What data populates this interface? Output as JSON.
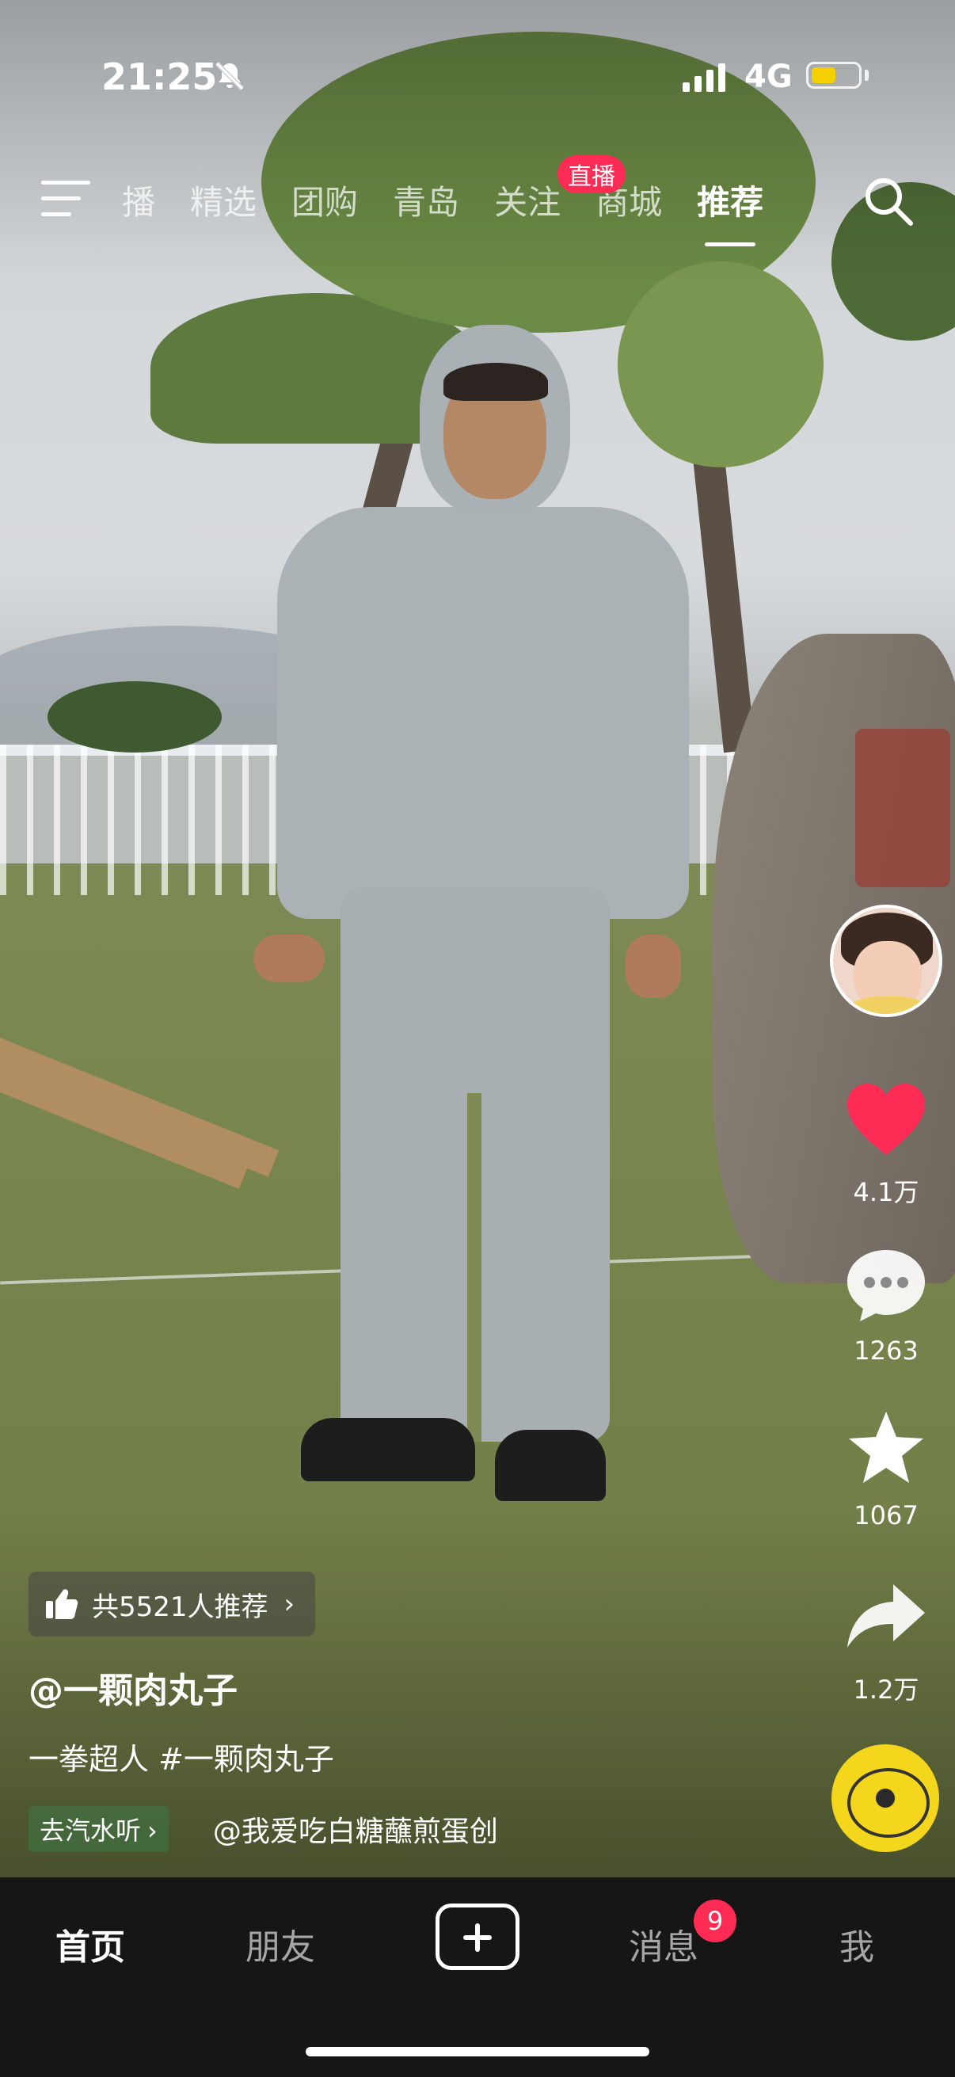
{
  "status_bar": {
    "time": "21:25",
    "network_type": "4G",
    "icons": [
      "bell-off-icon",
      "signal-icon",
      "battery-icon"
    ],
    "battery_color": "#f5d000"
  },
  "top_nav": {
    "tabs": [
      {
        "label": "播",
        "active": false
      },
      {
        "label": "精选",
        "active": false
      },
      {
        "label": "团购",
        "active": false
      },
      {
        "label": "青岛",
        "active": false
      },
      {
        "label": "关注",
        "active": false
      },
      {
        "label": "商城",
        "active": false
      },
      {
        "label": "推荐",
        "active": true
      }
    ],
    "live_badge": "直播",
    "accent_color": "#fe2c55"
  },
  "actions": {
    "like_count": "4.1万",
    "comment_count": "1263",
    "favorite_count": "1067",
    "share_count": "1.2万",
    "like_color": "#fe2c55"
  },
  "caption": {
    "recommend_text": "共5521人推荐",
    "author": "@一颗肉丸子",
    "description": "一拳超人 #一颗肉丸子",
    "music_tag": "去汽水听",
    "music_user": "@我爱吃白糖蘸煎蛋创"
  },
  "bottom_nav": {
    "items": [
      {
        "label": "首页",
        "active": true
      },
      {
        "label": "朋友",
        "active": false
      },
      {
        "label": "消息",
        "active": false
      },
      {
        "label": "我",
        "active": false
      }
    ],
    "message_badge": "9"
  }
}
